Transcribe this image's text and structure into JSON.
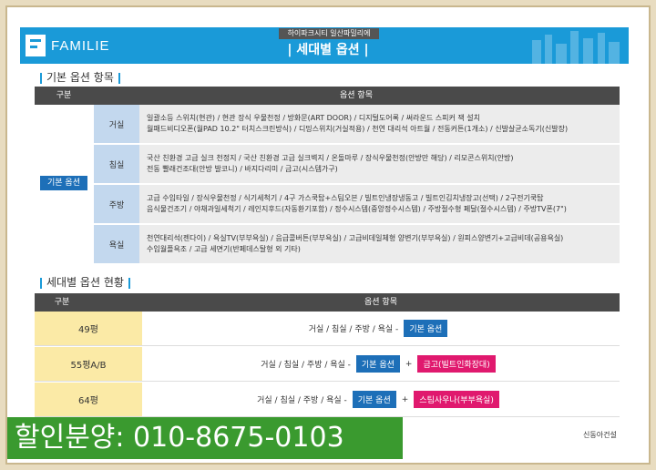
{
  "header": {
    "logo_text": "FAMILIE",
    "subtitle": "하이파크시티 일산파밀리에",
    "title": "| 세대별 옵션 |",
    "brand_color": "#1a9ad8"
  },
  "basic": {
    "section_title": "기본 옵션 항목",
    "col_category": "구분",
    "col_items": "옵션 항목",
    "group_label": "기본 옵션",
    "rows": [
      {
        "room": "거실",
        "lines": [
          "일괄소등 스위치(현관)  /  현관 장식 우물천정  /  방화문(ART DOOR)  /  디지털도어록  /  써라운드 스피커 잭 설치",
          "월패드비디오폰(월PAD 10.2\" 터치스크린방식)  /  디밍스위치(거실적용)  /  천연 대리석 아트월  /  전동커튼(1개소)  /  신발살균소독기(신발장)"
        ]
      },
      {
        "room": "침실",
        "lines": [
          "국산 친환경 고급 실크 천정지  /  국산 친환경 고급 실크벽지  /  온돌마루  /  장식우물천정(안방만 해당)  /  리모콘스위치(안방)",
          "전동 빨래건조대(안방 발코니)  /  바지다리미  /  금고(시스템가구)"
        ]
      },
      {
        "room": "주방",
        "lines": [
          "고급 수입타일  /  장식우물천정  /  식기세척기  /  4구 가스쿡탑+스팀오븐  /  빌트인냉장냉동고  /  빌트인김치냉장고(선택)  /  2구전기쿡탑",
          "음식물건조기  /  야채과일세척기  /  레인지후드(자동환기포함)  /  정수시스템(중앙정수시스템)  /  주방절수형 페달(절수시스템)  /  주방TV폰(7\")"
        ]
      },
      {
        "room": "욕실",
        "lines": [
          "천연대리석(젠다이)  /  욕실TV(부부욕실)  /  음급콜버튼(부부욕실)  /  고급비데일체형 양변기(부부욕실)  /  원피스양변기+고급비데(공용욕실)",
          "수입월플욕조  /  고급 세면기(반페데스탈형 외 기타)"
        ]
      }
    ]
  },
  "housing": {
    "section_title": "세대별 옵션 현황",
    "col_category": "구분",
    "col_items": "옵션 항목",
    "rows": [
      {
        "size": "49평",
        "rooms": "거실 / 침실 / 주방 / 욕실  -",
        "basic": "기본 옵션",
        "plus": "",
        "extra": ""
      },
      {
        "size": "55평A/B",
        "rooms": "거실 / 침실 / 주방 / 욕실  -",
        "basic": "기본 옵션",
        "plus": "+",
        "extra": "금고(빌트인화장대)"
      },
      {
        "size": "64평",
        "rooms": "거실 / 침실 / 주방 / 욕실  -",
        "basic": "기본 옵션",
        "plus": "+",
        "extra": "스팀사우나(부부욕실)"
      }
    ]
  },
  "promo": {
    "text": "할인분양: 010-8675-0103"
  },
  "builder": "신동아건설"
}
